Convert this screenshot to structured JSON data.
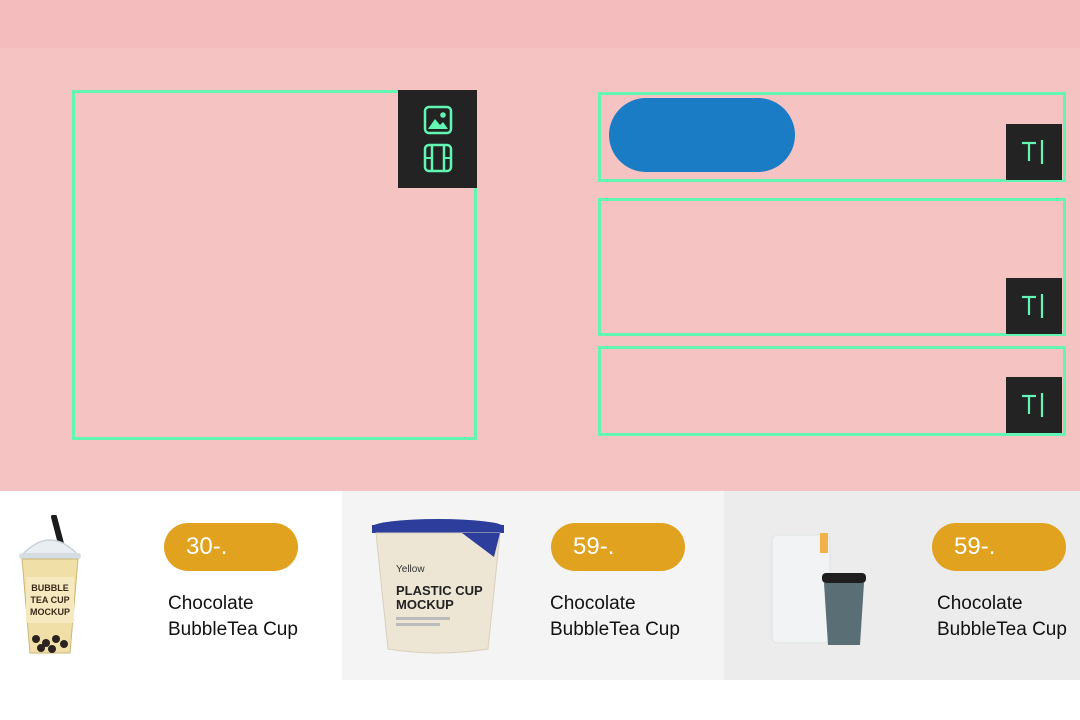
{
  "colors": {
    "canvas": "#f5c4c2",
    "frame_outline": "#63f5b3",
    "tool_panel": "#232323",
    "blue_pill": "#1a7cc5",
    "price_badge": "#e0a21f"
  },
  "tools": {
    "image_icon": "image-icon",
    "video_icon": "film-icon",
    "text_icon": "text-cursor-icon"
  },
  "products": [
    {
      "price": "30-.",
      "name_line1": "Chocolate",
      "name_line2": "BubbleTea Cup",
      "image": {
        "label_lines": [
          "BUBBLE",
          "TEA CUP",
          "MOCKUP"
        ]
      }
    },
    {
      "price": "59-.",
      "name_line1": "Chocolate",
      "name_line2": "BubbleTea Cup",
      "image": {
        "brand": "Yellow",
        "label_lines": [
          "PLASTIC CUP",
          "MOCKUP"
        ]
      }
    },
    {
      "price": "59-.",
      "name_line1": "Chocolate",
      "name_line2": "BubbleTea Cup",
      "image": {}
    }
  ]
}
